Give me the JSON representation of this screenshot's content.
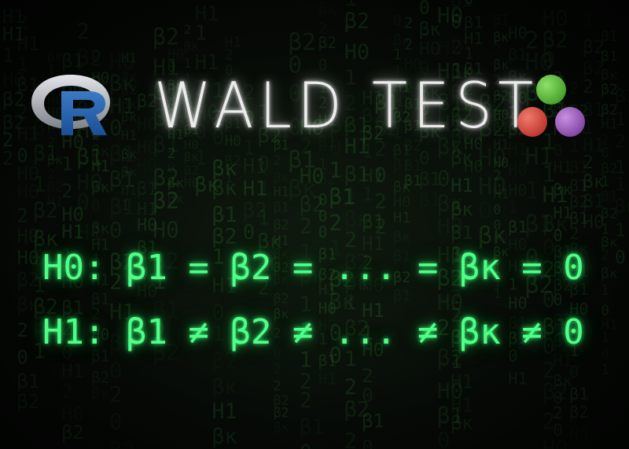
{
  "title": "WALD TEST",
  "hypotheses": {
    "h0": "H0: β1 = β2 = ... = βκ = 0",
    "h1": "H1: β1 ≠ β2 ≠ ... ≠ βκ ≠ 0"
  },
  "logos": {
    "left": "r-logo",
    "right": "jamovi-logo"
  },
  "colors": {
    "hypothesis_text": "#4dff88",
    "background_glyphs": "#2a6a2a",
    "title_text": "#ececec"
  },
  "background_glyphs": [
    "β1",
    "β2",
    "βκ",
    "H0",
    "H1",
    "0",
    "1",
    "2"
  ]
}
